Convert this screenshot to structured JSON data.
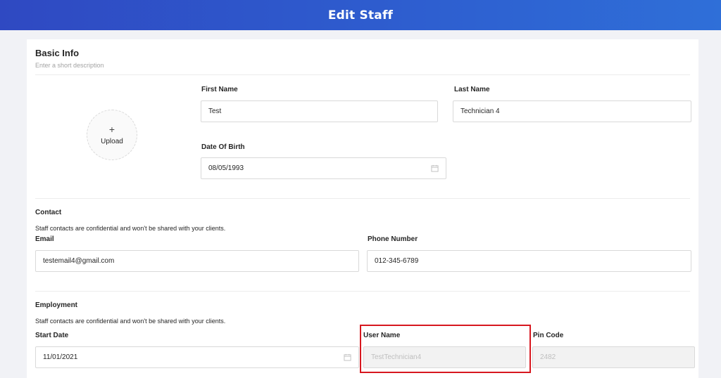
{
  "header": {
    "title": "Edit Staff"
  },
  "basic_info": {
    "title": "Basic Info",
    "subtitle": "Enter a short description",
    "upload_label": "Upload",
    "upload_plus": "+",
    "first_name": {
      "label": "First Name",
      "value": "Test"
    },
    "last_name": {
      "label": "Last Name",
      "value": "Technician 4"
    },
    "dob": {
      "label": "Date Of Birth",
      "value": "08/05/1993"
    }
  },
  "contact": {
    "title": "Contact",
    "note": "Staff contacts are confidential and won't be shared with your clients.",
    "email": {
      "label": "Email",
      "value": "testemail4@gmail.com"
    },
    "phone": {
      "label": "Phone Number",
      "value": "012-345-6789"
    }
  },
  "employment": {
    "title": "Employment",
    "note": "Staff contacts are confidential and won't be shared with your clients.",
    "start_date": {
      "label": "Start Date",
      "value": "11/01/2021"
    },
    "user_name": {
      "label": "User Name",
      "value": "TestTechnician4"
    },
    "pin_code": {
      "label": "Pin Code",
      "value": "2482"
    }
  },
  "colors": {
    "header_start": "#2f49c2",
    "header_end": "#2f6fd8",
    "highlight": "#d7171f",
    "disabled_bg": "#f2f2f2"
  }
}
